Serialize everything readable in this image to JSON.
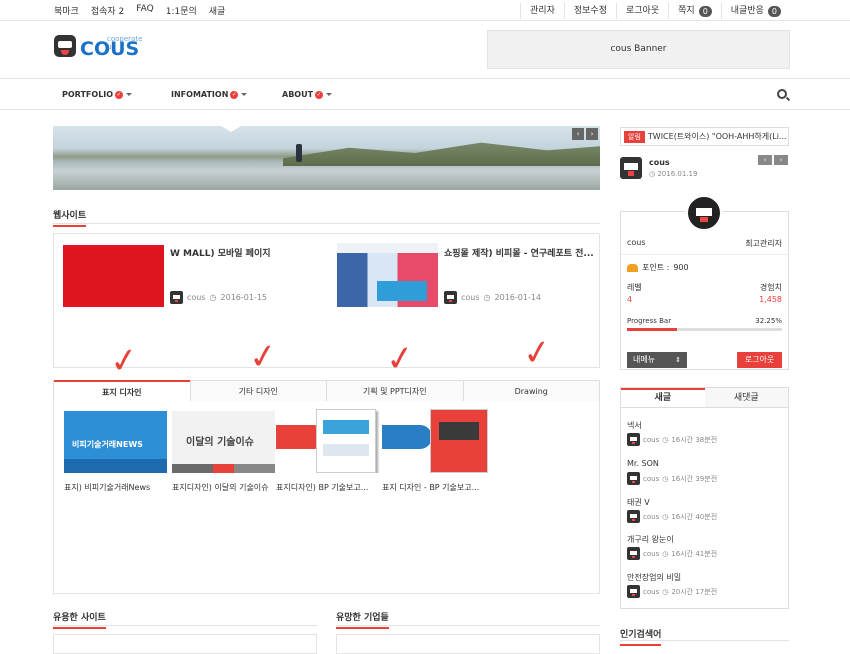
{
  "topbar": {
    "left": [
      "북마크",
      "접속자 2",
      "FAQ",
      "1:1문의",
      "새글"
    ],
    "right": [
      {
        "label": "관리자"
      },
      {
        "label": "정보수정"
      },
      {
        "label": "로그아웃"
      },
      {
        "label": "쪽지",
        "count": "0"
      },
      {
        "label": "내글반응",
        "count": "0"
      }
    ]
  },
  "logo": {
    "text": "COUS",
    "sub": "cooperate us"
  },
  "banner": {
    "text": "cous Banner"
  },
  "nav": {
    "items": [
      "PORTFOLIO",
      "INFOMATION",
      "ABOUT"
    ]
  },
  "website": {
    "title": "웹사이트",
    "posts": [
      {
        "title": "W MALL) 모바일 페이지",
        "author": "cous",
        "date": "2016-01-15"
      },
      {
        "title": "쇼핑몰 제작) 비피몰 - 연구레포트 전...",
        "author": "cous",
        "date": "2016-01-14"
      }
    ]
  },
  "tabs": {
    "labels": [
      "표지 디자인",
      "기타 디자인",
      "기획 및 PPT디자인",
      "Drawing"
    ],
    "items": [
      {
        "caption": "표지) 비피기술거래News",
        "thumb_text": "비피기술거래NEWS"
      },
      {
        "caption": "표지디자인) 이달의 기술이슈",
        "thumb_text": "이달의 기술이슈"
      },
      {
        "caption": "표지디자인) BP 기술보고...",
        "thumb_text": ""
      },
      {
        "caption": "표지 디자인 - BP 기술보고...",
        "thumb_text": ""
      }
    ]
  },
  "bottom": {
    "left_title": "유용한 사이트",
    "right_title": "유망한 기업들"
  },
  "sidebar": {
    "notice_label": "알림",
    "notice_text": "TWICE(트와이스) \"OOH-AHH하게(Li...",
    "author": "cous",
    "date": "2016.01.19",
    "profile": {
      "name": "cous",
      "role": "최고관리자",
      "point_label": "포인트 :",
      "points": "900",
      "level_label": "레벨",
      "level": "4",
      "exp_label": "경험치",
      "exp": "1,458",
      "progress_label": "Progress Bar",
      "progress": "32.25%",
      "progress_value": 0.3225,
      "menu_btn": "내메뉴",
      "logout_btn": "로그아웃"
    },
    "list_tabs": [
      "새글",
      "새댓글"
    ],
    "list": [
      {
        "title": "넥서",
        "author": "cous",
        "time": "16시간 38분전"
      },
      {
        "title": "Mr. SON",
        "author": "cous",
        "time": "16시간 39분전"
      },
      {
        "title": "태권 V",
        "author": "cous",
        "time": "16시간 40분전"
      },
      {
        "title": "개구리 왕눈이",
        "author": "cous",
        "time": "16시간 41분전"
      },
      {
        "title": "안전장업의 비밀",
        "author": "cous",
        "time": "20시간 17분전"
      }
    ],
    "popular_title": "인기검색어"
  }
}
